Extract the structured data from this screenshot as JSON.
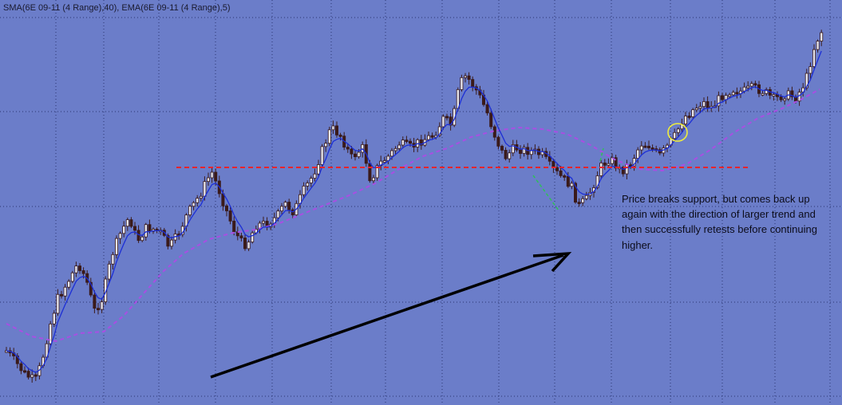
{
  "indicator_label": "SMA(6E 09-11 (4 Range),40), EMA(6E 09-11 (4 Range),5)",
  "annotation_text": "Price breaks support, but comes back up again with the direction of larger trend  and then successfully retests before continuing higher.",
  "colors": {
    "background": "#6b7dc9",
    "grid": "#2a3470",
    "candle": "#3a1a1a",
    "ema": "#1c2fd6",
    "sma": "#a84fe3",
    "support": "#e8242c",
    "arrow": "#000000",
    "green_path": "#2fbf5a",
    "circle": "#f0ee3a"
  },
  "chart_data": {
    "type": "candlestick",
    "series": [
      {
        "name": "SMA(6E 09-11 (4 Range),40)",
        "style": "dashed",
        "color": "#a84fe3"
      },
      {
        "name": "EMA(6E 09-11 (4 Range),5)",
        "style": "solid",
        "color": "#1c2fd6"
      }
    ],
    "support_level": "horizontal dashed red line",
    "grid": true,
    "axis_labels_visible": false
  }
}
